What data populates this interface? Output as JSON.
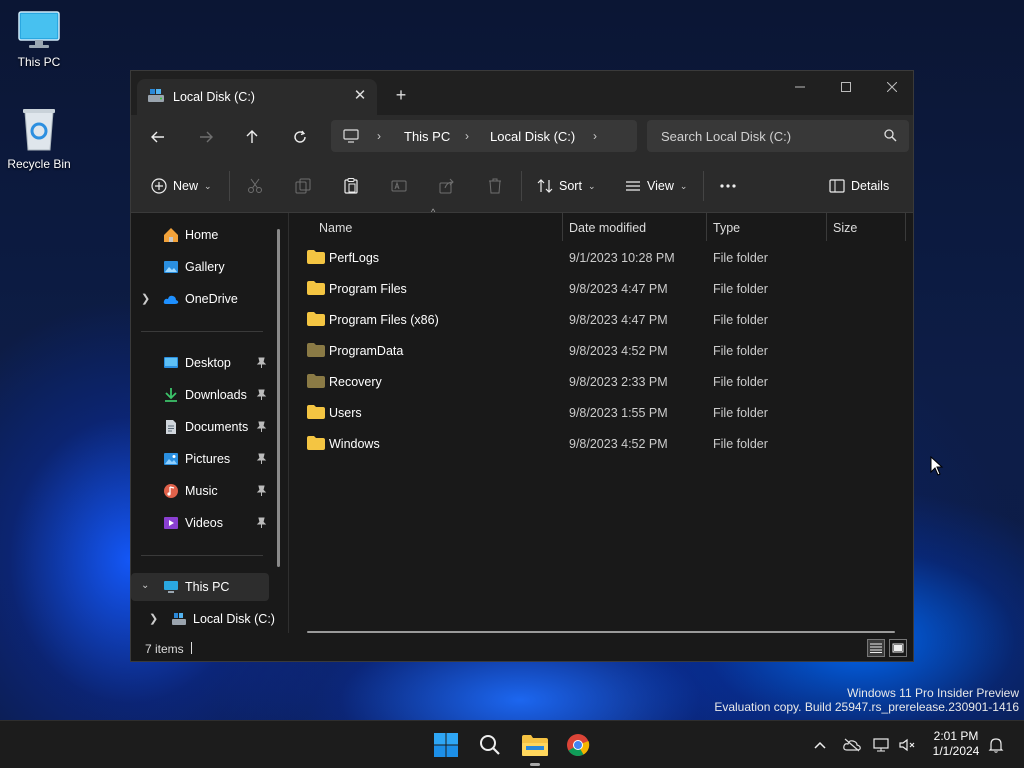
{
  "desktop": {
    "icons": [
      {
        "label": "This PC"
      },
      {
        "label": "Recycle Bin"
      }
    ],
    "watermark": {
      "line1": "Windows 11 Pro Insider Preview",
      "line2": "Evaluation copy. Build 25947.rs_prerelease.230901-1416"
    }
  },
  "window": {
    "tab_title": "Local Disk (C:)",
    "address": {
      "segments": [
        "This PC",
        "Local Disk (C:)"
      ]
    },
    "search": {
      "placeholder": "Search Local Disk (C:)"
    },
    "toolbar": {
      "new_label": "New",
      "sort_label": "Sort",
      "view_label": "View",
      "details_label": "Details"
    },
    "sidebar": {
      "top": [
        {
          "label": "Home",
          "icon": "home-icon"
        },
        {
          "label": "Gallery",
          "icon": "gallery-icon"
        },
        {
          "label": "OneDrive",
          "icon": "cloud-icon"
        }
      ],
      "quick": [
        {
          "label": "Desktop",
          "icon": "desktop-icon"
        },
        {
          "label": "Downloads",
          "icon": "download-icon"
        },
        {
          "label": "Documents",
          "icon": "documents-icon"
        },
        {
          "label": "Pictures",
          "icon": "pictures-icon"
        },
        {
          "label": "Music",
          "icon": "music-icon"
        },
        {
          "label": "Videos",
          "icon": "videos-icon"
        }
      ],
      "tree": [
        {
          "label": "This PC",
          "icon": "pc-icon"
        },
        {
          "label": "Local Disk (C:)",
          "icon": "drive-icon"
        }
      ]
    },
    "columns": [
      "Name",
      "Date modified",
      "Type",
      "Size"
    ],
    "files": [
      {
        "name": "PerfLogs",
        "date": "9/1/2023 10:28 PM",
        "type": "File folder"
      },
      {
        "name": "Program Files",
        "date": "9/8/2023 4:47 PM",
        "type": "File folder"
      },
      {
        "name": "Program Files (x86)",
        "date": "9/8/2023 4:47 PM",
        "type": "File folder"
      },
      {
        "name": "ProgramData",
        "date": "9/8/2023 4:52 PM",
        "type": "File folder"
      },
      {
        "name": "Recovery",
        "date": "9/8/2023 2:33 PM",
        "type": "File folder"
      },
      {
        "name": "Users",
        "date": "9/8/2023 1:55 PM",
        "type": "File folder"
      },
      {
        "name": "Windows",
        "date": "9/8/2023 4:52 PM",
        "type": "File folder"
      }
    ],
    "status": {
      "item_count": "7 items"
    }
  },
  "taskbar": {
    "clock": {
      "time": "2:01 PM",
      "date": "1/1/2024"
    }
  },
  "colors": {
    "folder": "#f4c542",
    "folder_hidden": "#8a7a45",
    "accent": "#0078d4"
  }
}
